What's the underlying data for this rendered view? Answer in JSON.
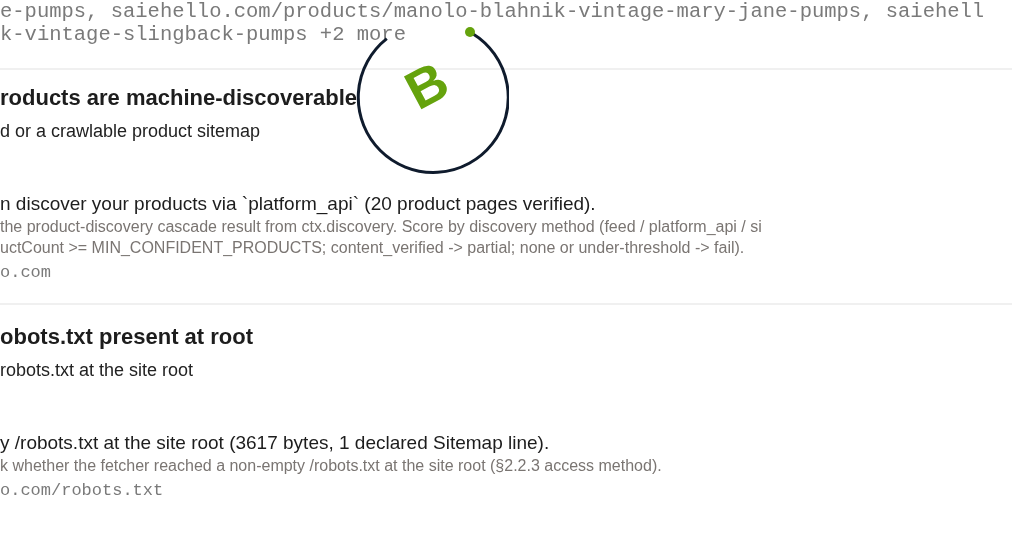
{
  "previous_evidence": {
    "lines": [
      "e-pumps, saiehello.com/products/manolo-blahnik-vintage-mary-jane-pumps, saiehell",
      "k-vintage-slingback-pumps +2 more"
    ]
  },
  "grade_seal": {
    "grade": "B"
  },
  "checks": [
    {
      "title": "roducts are machine-discoverable",
      "description": "d or a crawlable product sitemap",
      "result": "n discover your products via `platform_api` (20 product pages verified).",
      "method_lines": [
        "the product-discovery cascade result from ctx.discovery. Score by discovery method (feed / platform_api / si",
        "uctCount >= MIN_CONFIDENT_PRODUCTS; content_verified -> partial; none or under-threshold -> fail)."
      ],
      "evidence": "o.com"
    },
    {
      "title": "obots.txt present at root",
      "description": "robots.txt at the site root",
      "result": "y /robots.txt at the site root (3617 bytes, 1 declared Sitemap line).",
      "method_lines": [
        "k whether the fetcher reached a non-empty /robots.txt at the site root (§2.2.3 access method)."
      ],
      "evidence": "o.com/robots.txt"
    }
  ]
}
